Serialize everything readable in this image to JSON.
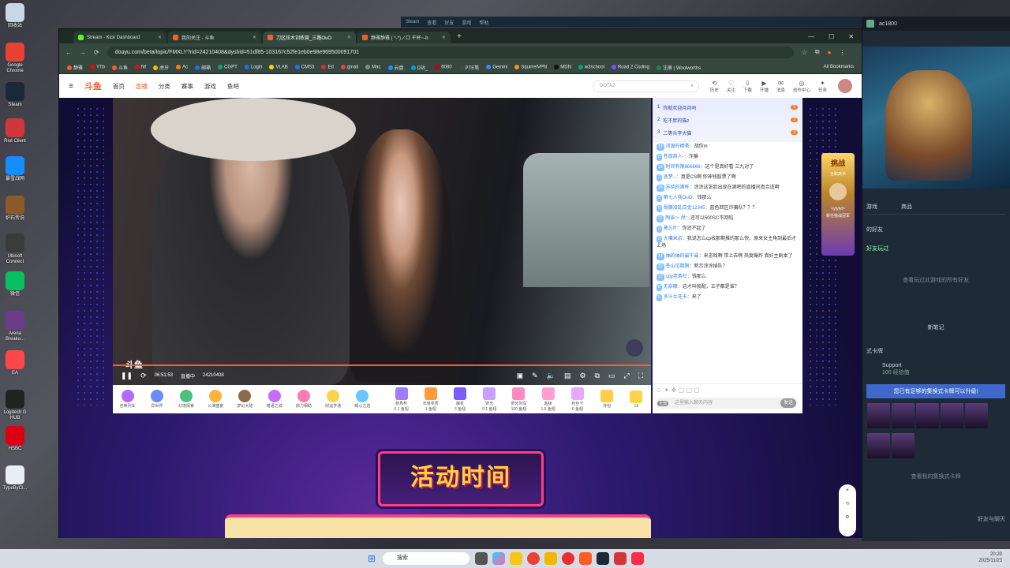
{
  "desktop": {
    "icons": [
      {
        "label": "回收站",
        "color": "#c9d6e6"
      },
      {
        "label": "Google Chrome",
        "color": "#e94235"
      },
      {
        "label": "Steam",
        "color": "#1b2838"
      },
      {
        "label": "Riot Client",
        "color": "#d13639"
      },
      {
        "label": "暴雪战网",
        "color": "#148eff"
      },
      {
        "label": "炉石传说",
        "color": "#8a5a2a"
      },
      {
        "label": "Ubisoft Connect",
        "color": "#3b3b3b"
      },
      {
        "label": "微信",
        "color": "#07c160"
      },
      {
        "label": "Arena Breako...",
        "color": "#6b3c8a"
      },
      {
        "label": "EA",
        "color": "#ff4747"
      },
      {
        "label": "Logitech G HUB",
        "color": "#222"
      },
      {
        "label": "HSBC",
        "color": "#db0011"
      },
      {
        "label": "TypeByCl...",
        "color": "#e9edf6"
      }
    ]
  },
  "steam": {
    "menu": [
      "Steam",
      "查看",
      "好友",
      "游戏",
      "帮助"
    ],
    "user": "ac1800",
    "tabs": [
      "游戏",
      "商品"
    ],
    "friends_title": "的好友",
    "friend_played": "好友玩过",
    "view_all": "查看玩过此游戏的所有好友",
    "notes_title": "新笔记",
    "cards_title": "式卡牌",
    "support_label": "Support",
    "xp": "100 经验值",
    "upgrade": "您已有足够的集换式卡牌可以升级!",
    "view_cards": "查看我的集换式卡牌",
    "chat": "好友与聊天"
  },
  "browser": {
    "tabs": [
      {
        "label": "Stream - Kick Dashboard",
        "active": false
      },
      {
        "label": "我的关注 - 斗鱼",
        "active": false
      },
      {
        "label": "刀区炫木训练营_三路OuO",
        "active": true
      },
      {
        "label": "静雅静雅 ( *-*)ノ口 干杯~-b",
        "active": false
      }
    ],
    "new_tab": "+",
    "url": "douyu.com/beta/topic/FMXLY?rid=24210408&dyshid=51df85-103167c52fe1eb0e98e969500091701",
    "bookmarks": [
      {
        "label": "静雅",
        "color": "#ff5d23"
      },
      {
        "label": "YTb",
        "color": "#f00"
      },
      {
        "label": "斗鱼",
        "color": "#ff5d23"
      },
      {
        "label": "Nf",
        "color": "#e50914"
      },
      {
        "label": "虎牙",
        "color": "#ffb300"
      },
      {
        "label": "Ac",
        "color": "#ff7b1c"
      },
      {
        "label": "邮箱",
        "color": "#1a73e8"
      },
      {
        "label": "CGPT",
        "color": "#10a37f"
      },
      {
        "label": "Login",
        "color": "#1a73e8"
      },
      {
        "label": "VLAB",
        "color": "#ffd400"
      },
      {
        "label": "CMS3",
        "color": "#2c6bed"
      },
      {
        "label": "Ed",
        "color": "#cc3333"
      },
      {
        "label": "gmail",
        "color": "#ea4335"
      },
      {
        "label": "Mac",
        "color": "#888"
      },
      {
        "label": "云盘",
        "color": "#1e90ff"
      },
      {
        "label": "D站_",
        "color": "#00a1d6"
      },
      {
        "label": "6080",
        "color": "#cc0000"
      },
      {
        "label": "PTE笔",
        "color": "#444"
      },
      {
        "label": "Gemini",
        "color": "#4285f4"
      },
      {
        "label": "SquirrelVPN",
        "color": "#f7931e"
      },
      {
        "label": "MDN",
        "color": "#111"
      },
      {
        "label": "w3school",
        "color": "#04aa6d"
      },
      {
        "label": "Road 2 Coding",
        "color": "#7c4dff"
      },
      {
        "label": "注册 | Woolworths",
        "color": "#178841"
      }
    ],
    "all_bookmarks": "All Bookmarks"
  },
  "site": {
    "logo": "斗鱼",
    "nav": [
      "首页",
      "直播",
      "分类",
      "赛事",
      "游戏",
      "鱼吧"
    ],
    "search_placeholder": "DOTA2",
    "right_icons": [
      "历史",
      "关注",
      "下载",
      "开播",
      "消息",
      "创作中心",
      "任务"
    ]
  },
  "player": {
    "time": "06:51:53",
    "live": "直播中",
    "room": "24210408",
    "watermark": "斗鱼"
  },
  "gifts": [
    "召唤列车",
    "异世界",
    "幻境探索",
    "公演盛宴",
    "梦幻大陆",
    "暗语之城",
    "鼎力相助",
    "财运亨通",
    "暖心之选"
  ],
  "gift_right": [
    {
      "label": "新秀杯",
      "sub": "0.1 鱼翅"
    },
    {
      "label": "年度奖赏",
      "sub": "1 鱼翅"
    },
    {
      "label": "魔杖",
      "sub": "3 鱼翅"
    },
    {
      "label": "荧光",
      "sub": "0.1 鱼翅"
    },
    {
      "label": "荧光列车",
      "sub": "100 鱼翅"
    },
    {
      "label": "超级",
      "sub": "1.5 鱼翅"
    },
    {
      "label": "粉丝卡",
      "sub": "6 鱼翅"
    },
    {
      "label": "背包",
      "sub": ""
    },
    {
      "label": "13",
      "sub": ""
    }
  ],
  "chat": {
    "rank": [
      {
        "n": "1",
        "name": "你就欢迎月月吗",
        "lv": "3"
      },
      {
        "n": "2",
        "name": "吃不胖的猫z",
        "lv": "3"
      },
      {
        "n": "3",
        "name": "二等兵李大猫",
        "lv": "3"
      }
    ],
    "messages": [
      {
        "lv": "12",
        "name": "河源柠檬茶：",
        "text": "战你m"
      },
      {
        "lv": "8",
        "name": "苍旅商人-：",
        "text": "诈骗"
      },
      {
        "lv": "15",
        "name": "时间有限666666：",
        "text": "这个是真好看 三九对了"
      },
      {
        "lv": "7",
        "name": "逐梦--：",
        "text": "真是CS啊 你神钱股票了啊"
      },
      {
        "lv": "20",
        "name": "苏晓的酒杯：",
        "text": "涂涂这张脸出现在酒吧的直播间真合适啊"
      },
      {
        "lv": "5",
        "name": "第七人我OuO：",
        "text": "钱那么"
      },
      {
        "lv": "9",
        "name": "骨骼凌乱白金12345：",
        "text": "蓝色回区诈骗队？？？"
      },
      {
        "lv": "11",
        "name": "陶诶～ 然：",
        "text": "还可以500SC不回啦"
      },
      {
        "lv": "3",
        "name": "莫忘叶：",
        "text": "你还不起了"
      },
      {
        "lv": "6",
        "name": "大嘴米余：",
        "text": "我说怎么cp找那期推的那么快，原来女主角到最后才上场"
      },
      {
        "lv": "14",
        "name": "抽的抽的最牛最：",
        "text": "来态戏啊 带上去啊 热度爆炸 真好主剧本了"
      },
      {
        "lv": "10",
        "name": "苍山见期限：",
        "text": "新示涂涂插队？"
      },
      {
        "lv": "12",
        "name": "spy老茶社：",
        "text": "钱那么"
      },
      {
        "lv": "8",
        "name": "无奈摩：",
        "text": "这才叫般配，五子都是谁？"
      },
      {
        "lv": "5",
        "name": "多汁兰花卡：",
        "text": "来了"
      }
    ],
    "placeholder": "这里输入聊天内容",
    "send": "发送",
    "fans_label": "全部"
  },
  "side_badge": {
    "title": "挑战",
    "sub": "全职高手",
    "name": "<yfyfyf>",
    "note": "新任挑战冠军"
  },
  "banner": "活动时间",
  "taskbar": {
    "search": "搜索",
    "time": "20:20",
    "date": "2025/11/23"
  }
}
